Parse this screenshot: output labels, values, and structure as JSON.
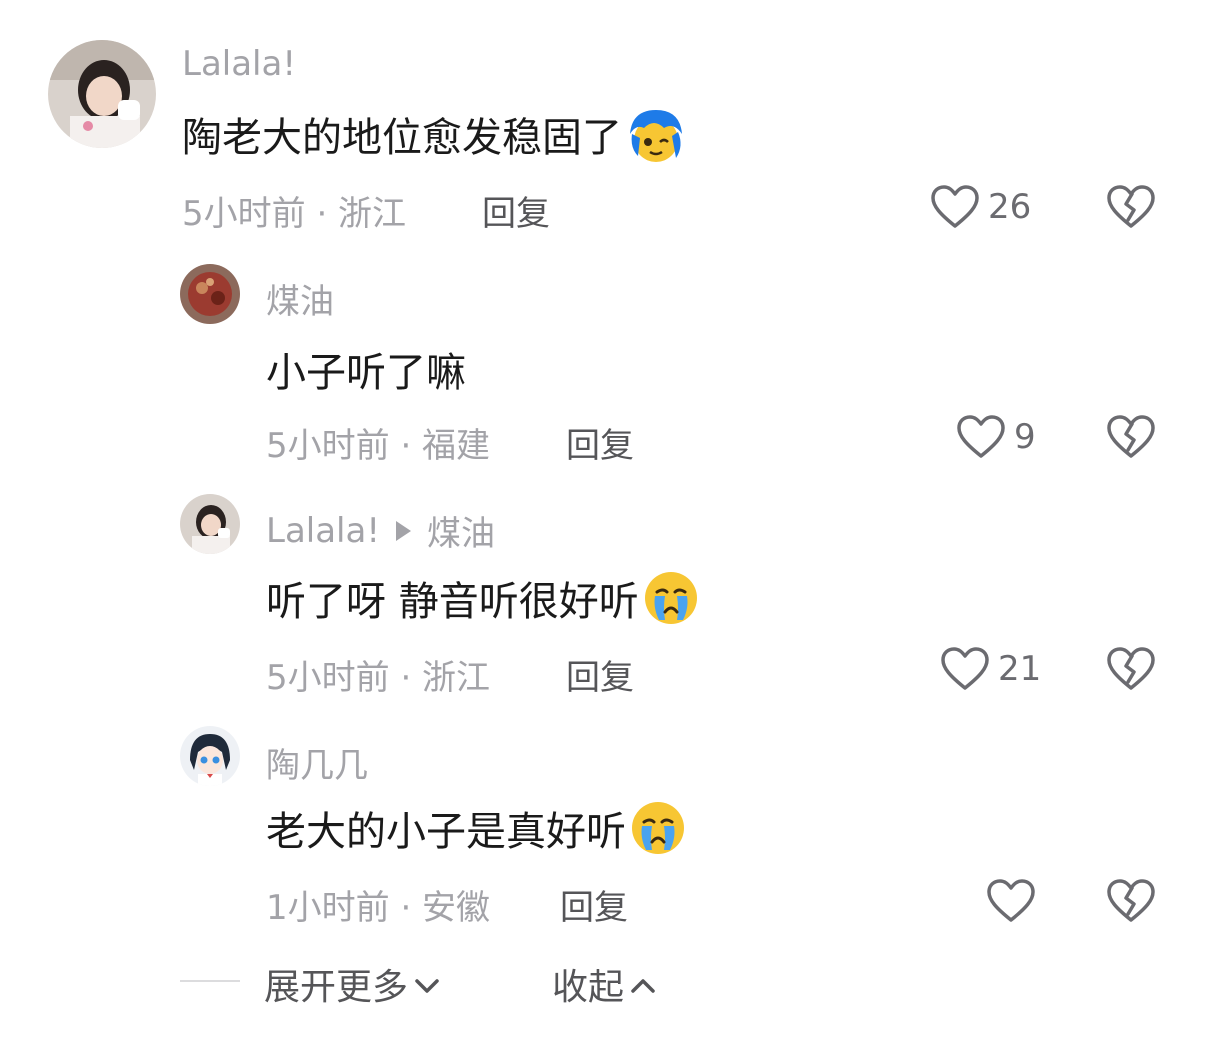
{
  "comments": [
    {
      "username": "Lalala!",
      "reply_to": "",
      "text": "陶老大的地位愈发稳固了",
      "emoji": "blue-hair-wink-emoji",
      "time_location": "5小时前 · 浙江",
      "reply_label": "回复",
      "likes": "26"
    },
    {
      "username": "煤油",
      "reply_to": "",
      "text": "小子听了嘛",
      "emoji": "",
      "time_location": "5小时前 · 福建",
      "reply_label": "回复",
      "likes": "9"
    },
    {
      "username": "Lalala!",
      "reply_to": "煤油",
      "text": "听了呀 静音听很好听",
      "emoji": "crying-face-emoji",
      "time_location": "5小时前 · 浙江",
      "reply_label": "回复",
      "likes": "21"
    },
    {
      "username": "陶几几",
      "reply_to": "",
      "text": "老大的小子是真好听",
      "emoji": "crying-face-emoji",
      "time_location": "1小时前 · 安徽",
      "reply_label": "回复",
      "likes": ""
    }
  ],
  "footer": {
    "expand_label": "展开更多",
    "collapse_label": "收起"
  },
  "colors": {
    "secondary_text": "#a3a3a8",
    "primary_text": "#1a1a1a",
    "icon_stroke": "#6b6b70"
  }
}
